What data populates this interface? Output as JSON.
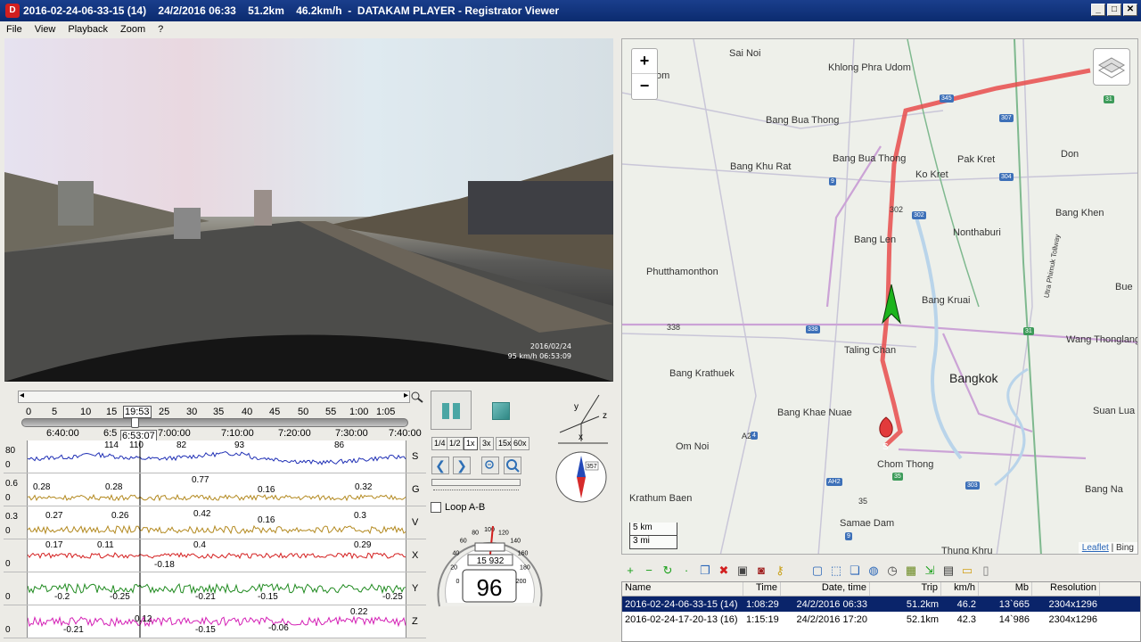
{
  "window": {
    "title": "2016-02-24-06-33-15 (14)    24/2/2016 06:33    51.2km    46.2km/h  -  DATAKAM PLAYER - Registrator Viewer",
    "app_icon": "app-logo-icon",
    "buttons": [
      "_",
      "□",
      "✕"
    ]
  },
  "menu": [
    "File",
    "View",
    "Playback",
    "Zoom",
    "?"
  ],
  "video": {
    "overlay_line1": "2016/02/24",
    "overlay_line2": "95 km/h 06:53:09"
  },
  "timeline": {
    "minute_ticks": [
      "0",
      "5",
      "10",
      "15",
      "19:53",
      "25",
      "30",
      "35",
      "40",
      "45",
      "50",
      "55",
      "1:00",
      "1:05"
    ],
    "clock_ticks": [
      "6:40:00",
      "6:5",
      "6:53:07",
      "7:00:00",
      "7:10:00",
      "7:20:00",
      "7:30:00",
      "7:40:00"
    ],
    "position_fraction": 0.29
  },
  "graphs": [
    {
      "letter": "S",
      "axis_top": "80",
      "axis_bottom": "0",
      "color": "#1f2fb5",
      "annotations": [
        "114",
        "110",
        "82",
        "93",
        "86"
      ]
    },
    {
      "letter": "G",
      "axis_top": "0.6",
      "axis_bottom": "0",
      "color": "#b3891f",
      "annotations": [
        "0.28",
        "0.28",
        "0.77",
        "0.16",
        "0.32"
      ]
    },
    {
      "letter": "V",
      "axis_top": "0.3",
      "axis_bottom": "0",
      "color": "#b3891f",
      "annotations": [
        "0.27",
        "0.26",
        "0.42",
        "0.16",
        "0.3"
      ]
    },
    {
      "letter": "X",
      "axis_top": "",
      "axis_bottom": "0",
      "color": "#d41f1f",
      "annotations": [
        "0.17",
        "0.11",
        "-0.18",
        "0.4",
        "0.29"
      ]
    },
    {
      "letter": "Y",
      "axis_top": "",
      "axis_bottom": "0",
      "color": "#1f8a1f",
      "annotations": [
        "-0.2",
        "-0.25",
        "-0.21",
        "-0.15",
        "-0.25"
      ]
    },
    {
      "letter": "Z",
      "axis_top": "",
      "axis_bottom": "0",
      "color": "#d41fb5",
      "annotations": [
        "-0.21",
        "0.12",
        "-0.15",
        "-0.06",
        "0.22"
      ]
    }
  ],
  "controls": {
    "speeds": [
      "1/4",
      "1/2",
      "1x",
      "3x",
      "15x",
      "60x"
    ],
    "active_speed": "1x",
    "loop_label": "Loop A-B",
    "compass_heading": "357",
    "speedo_km": "15 932",
    "speedo_speed": "96",
    "speedo_scale": [
      "0",
      "20",
      "40",
      "60",
      "80",
      "100",
      "120",
      "140",
      "160",
      "180",
      "200"
    ],
    "axis_labels": {
      "x": "x",
      "y": "y",
      "z": "z"
    }
  },
  "map": {
    "labels": [
      {
        "t": "Sai Noi",
        "big": false
      },
      {
        "t": "Khlong Phra Udom",
        "big": false
      },
      {
        "t": "Bang Bua Thong",
        "big": false
      },
      {
        "t": "Bang Khu Rat",
        "big": false
      },
      {
        "t": "Bang Bua Thong",
        "big": false
      },
      {
        "t": "Pak Kret",
        "big": false
      },
      {
        "t": "Ko Kret",
        "big": false
      },
      {
        "t": "Don",
        "big": false
      },
      {
        "t": "Bang Khen",
        "big": false
      },
      {
        "t": "Nonthaburi",
        "big": false
      },
      {
        "t": "Bang Len",
        "big": false
      },
      {
        "t": "Phutthamonthon",
        "big": false
      },
      {
        "t": "Bang Kruai",
        "big": false
      },
      {
        "t": "Bue",
        "big": false
      },
      {
        "t": "Wang Thonglang",
        "big": false
      },
      {
        "t": "Taling Chan",
        "big": false
      },
      {
        "t": "Bang Krathuek",
        "big": false
      },
      {
        "t": "Bangkok",
        "big": true
      },
      {
        "t": "Bang Khae Nuae",
        "big": false
      },
      {
        "t": "Suan Lua",
        "big": false
      },
      {
        "t": "Om Noi",
        "big": false
      },
      {
        "t": "Chom Thong",
        "big": false
      },
      {
        "t": "Krathum Baen",
        "big": false
      },
      {
        "t": "Bang Na",
        "big": false
      },
      {
        "t": "Samae Dam",
        "big": false
      },
      {
        "t": "Thung Khru",
        "big": false
      },
      {
        "t": "om",
        "big": false
      },
      {
        "t": "A2",
        "big": false
      },
      {
        "t": "338",
        "big": false
      },
      {
        "t": "302",
        "big": false
      },
      {
        "t": "35",
        "big": false
      },
      {
        "t": "Utra Phimuk Tollway",
        "big": false
      }
    ],
    "shields": [
      "345",
      "307",
      "31",
      "9",
      "304",
      "302",
      "338",
      "31",
      "4",
      "AH2",
      "35",
      "303",
      "9"
    ],
    "zoom_in": "+",
    "zoom_out": "−",
    "scale_km": "5 km",
    "scale_mi": "3 mi",
    "attribution_link": "Leaflet",
    "attribution_sep": " | Bing",
    "start_marker": "S",
    "route_color": "#e84c4c"
  },
  "toolbar_icons": [
    "add-icon",
    "remove-icon",
    "refresh-icon",
    "dot-icon",
    "copy-icon",
    "delete-icon",
    "save-icon",
    "camera-icon",
    "key-icon",
    "sep-icon",
    "frame-icon",
    "crop-icon",
    "layers-icon",
    "globe-icon",
    "speed-icon",
    "grid-icon",
    "export-icon",
    "photo-icon",
    "folder-icon",
    "doc-icon"
  ],
  "file_table": {
    "columns": [
      "Name",
      "Time",
      "Date, time",
      "Trip",
      "km/h",
      "Mb",
      "Resolution"
    ],
    "rows": [
      {
        "name": "2016-02-24-06-33-15 (14)",
        "time": "1:08:29",
        "datetime": "24/2/2016 06:33",
        "trip": "51.2km",
        "kmh": "46.2",
        "mb": "13`665",
        "res": "2304x1296",
        "selected": true
      },
      {
        "name": "2016-02-24-17-20-13 (16)",
        "time": "1:15:19",
        "datetime": "24/2/2016 17:20",
        "trip": "52.1km",
        "kmh": "42.3",
        "mb": "14`986",
        "res": "2304x1296",
        "selected": false
      }
    ]
  }
}
